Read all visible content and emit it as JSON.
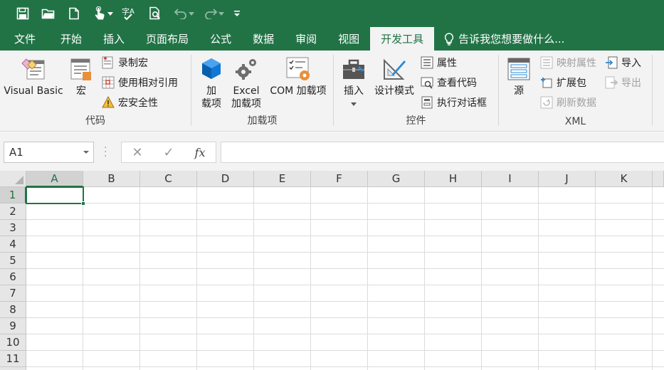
{
  "quick_access": {
    "icons": [
      "save-icon",
      "open-folder-icon",
      "new-file-icon",
      "touch-mode-icon",
      "spelling-icon",
      "print-preview-icon",
      "undo-icon",
      "redo-icon",
      "customize-icon"
    ]
  },
  "tabs": [
    "文件",
    "开始",
    "插入",
    "页面布局",
    "公式",
    "数据",
    "审阅",
    "视图",
    "开发工具"
  ],
  "active_tab": "开发工具",
  "tell_me": "告诉我您想要做什么...",
  "ribbon": {
    "code": {
      "label": "代码",
      "visual_basic": "Visual Basic",
      "macros": "宏",
      "record_macro": "录制宏",
      "relative_ref": "使用相对引用",
      "macro_security": "宏安全性"
    },
    "addins": {
      "label": "加载项",
      "addins_line1": "加",
      "addins_line2": "载项",
      "excel_addins_line1": "Excel",
      "excel_addins_line2": "加载项",
      "com_addins": "COM 加载项"
    },
    "controls": {
      "label": "控件",
      "insert": "插入",
      "design_mode": "设计模式",
      "properties": "属性",
      "view_code": "查看代码",
      "run_dialog": "执行对话框"
    },
    "xml": {
      "label": "XML",
      "source": "源",
      "map_properties": "映射属性",
      "expansion_packs": "扩展包",
      "refresh_data": "刷新数据",
      "import": "导入",
      "export": "导出"
    }
  },
  "formula_bar": {
    "name_box": "A1",
    "cancel": "✕",
    "enter": "✓",
    "fx": "fx",
    "formula": ""
  },
  "sheet": {
    "columns": [
      "A",
      "B",
      "C",
      "D",
      "E",
      "F",
      "G",
      "H",
      "I",
      "J",
      "K"
    ],
    "rows": [
      "1",
      "2",
      "3",
      "4",
      "5",
      "6",
      "7",
      "8",
      "9",
      "10",
      "11"
    ],
    "active_cell": "A1"
  },
  "colors": {
    "brand": "#217346",
    "ribbon_bg": "#f3f3f3",
    "header_bg": "#e6e6e6",
    "gridline": "#dadcdd"
  }
}
